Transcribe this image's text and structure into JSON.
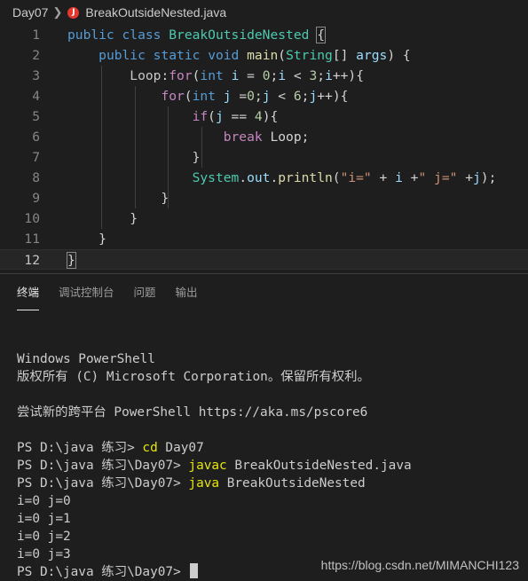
{
  "breadcrumb": {
    "folder": "Day07",
    "file_icon": "java-error-icon",
    "file_icon_letter": "J",
    "file": "BreakOutsideNested.java"
  },
  "editor": {
    "lines": [
      {
        "n": "1",
        "tokens": [
          [
            "kw",
            "public"
          ],
          [
            "p",
            " "
          ],
          [
            "kw",
            "class"
          ],
          [
            "p",
            " "
          ],
          [
            "ty",
            "BreakOutsideNested"
          ],
          [
            "p",
            " "
          ],
          [
            "brm",
            "{"
          ]
        ]
      },
      {
        "n": "2",
        "tokens": [
          [
            "p",
            "    "
          ],
          [
            "kw",
            "public"
          ],
          [
            "p",
            " "
          ],
          [
            "kw",
            "static"
          ],
          [
            "p",
            " "
          ],
          [
            "kw",
            "void"
          ],
          [
            "p",
            " "
          ],
          [
            "fn",
            "main"
          ],
          [
            "p",
            "("
          ],
          [
            "ty",
            "String"
          ],
          [
            "p",
            "[] "
          ],
          [
            "var",
            "args"
          ],
          [
            "p",
            ") {"
          ]
        ]
      },
      {
        "n": "3",
        "tokens": [
          [
            "p",
            "        "
          ],
          [
            "label",
            "Loop"
          ],
          [
            "p",
            ":"
          ],
          [
            "ctl",
            "for"
          ],
          [
            "p",
            "("
          ],
          [
            "kw",
            "int"
          ],
          [
            "p",
            " "
          ],
          [
            "var",
            "i"
          ],
          [
            "p",
            " = "
          ],
          [
            "num",
            "0"
          ],
          [
            "p",
            ";"
          ],
          [
            "var",
            "i"
          ],
          [
            "p",
            " < "
          ],
          [
            "num",
            "3"
          ],
          [
            "p",
            ";"
          ],
          [
            "var",
            "i"
          ],
          [
            "p",
            "++){"
          ]
        ]
      },
      {
        "n": "4",
        "tokens": [
          [
            "p",
            "            "
          ],
          [
            "ctl",
            "for"
          ],
          [
            "p",
            "("
          ],
          [
            "kw",
            "int"
          ],
          [
            "p",
            " "
          ],
          [
            "var",
            "j"
          ],
          [
            "p",
            " ="
          ],
          [
            "num",
            "0"
          ],
          [
            "p",
            ";"
          ],
          [
            "var",
            "j"
          ],
          [
            "p",
            " < "
          ],
          [
            "num",
            "6"
          ],
          [
            "p",
            ";"
          ],
          [
            "var",
            "j"
          ],
          [
            "p",
            "++){"
          ]
        ]
      },
      {
        "n": "5",
        "tokens": [
          [
            "p",
            "                "
          ],
          [
            "ctl",
            "if"
          ],
          [
            "p",
            "("
          ],
          [
            "var",
            "j"
          ],
          [
            "p",
            " == "
          ],
          [
            "num",
            "4"
          ],
          [
            "p",
            "){"
          ]
        ]
      },
      {
        "n": "6",
        "tokens": [
          [
            "p",
            "                    "
          ],
          [
            "ctl",
            "break"
          ],
          [
            "p",
            " Loop;"
          ]
        ]
      },
      {
        "n": "7",
        "tokens": [
          [
            "p",
            "                }"
          ]
        ]
      },
      {
        "n": "8",
        "tokens": [
          [
            "p",
            "                "
          ],
          [
            "ty",
            "System"
          ],
          [
            "p",
            "."
          ],
          [
            "var",
            "out"
          ],
          [
            "p",
            "."
          ],
          [
            "fn",
            "println"
          ],
          [
            "p",
            "("
          ],
          [
            "str",
            "\"i=\""
          ],
          [
            "p",
            " + "
          ],
          [
            "var",
            "i"
          ],
          [
            "p",
            " +"
          ],
          [
            "str",
            "\" j=\""
          ],
          [
            "p",
            " +"
          ],
          [
            "var",
            "j"
          ],
          [
            "p",
            ");"
          ]
        ]
      },
      {
        "n": "9",
        "tokens": [
          [
            "p",
            "            }"
          ]
        ]
      },
      {
        "n": "10",
        "tokens": [
          [
            "p",
            "        }"
          ]
        ]
      },
      {
        "n": "11",
        "tokens": [
          [
            "p",
            "    }"
          ]
        ]
      },
      {
        "n": "12",
        "tokens": [
          [
            "brm",
            "}"
          ]
        ]
      }
    ]
  },
  "panel": {
    "tabs": [
      "终端",
      "调试控制台",
      "问题",
      "输出"
    ]
  },
  "terminal": {
    "lines": [
      [
        [
          "t",
          "Windows PowerShell"
        ]
      ],
      [
        [
          "t",
          "版权所有 (C) Microsoft Corporation。保留所有权利。"
        ]
      ],
      [
        [
          "t",
          ""
        ]
      ],
      [
        [
          "t",
          "尝试新的跨平台 PowerShell https://aka.ms/pscore6"
        ]
      ],
      [
        [
          "t",
          ""
        ]
      ],
      [
        [
          "t",
          "PS D:\\java 练习> "
        ],
        [
          "cmd",
          "cd"
        ],
        [
          "t",
          " Day07"
        ]
      ],
      [
        [
          "t",
          "PS D:\\java 练习\\Day07> "
        ],
        [
          "cmd",
          "javac"
        ],
        [
          "t",
          " BreakOutsideNested.java"
        ]
      ],
      [
        [
          "t",
          "PS D:\\java 练习\\Day07> "
        ],
        [
          "cmd",
          "java"
        ],
        [
          "t",
          " BreakOutsideNested"
        ]
      ],
      [
        [
          "t",
          "i=0 j=0"
        ]
      ],
      [
        [
          "t",
          "i=0 j=1"
        ]
      ],
      [
        [
          "t",
          "i=0 j=2"
        ]
      ],
      [
        [
          "t",
          "i=0 j=3"
        ]
      ],
      [
        [
          "t",
          "PS D:\\java 练习\\Day07> "
        ],
        [
          "cursor",
          ""
        ]
      ]
    ]
  },
  "watermark": "https://blog.csdn.net/MIMANCHI123"
}
